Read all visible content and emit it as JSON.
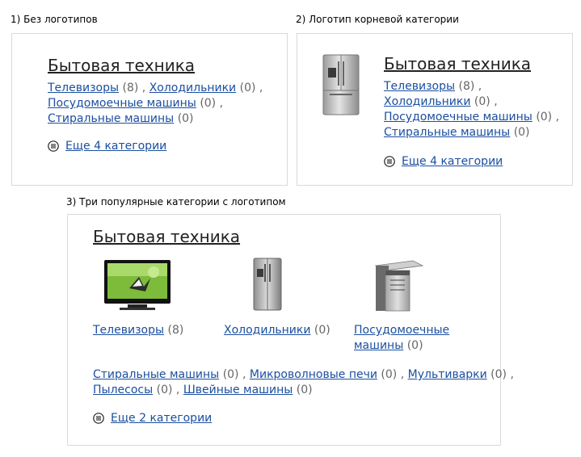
{
  "example1": {
    "caption": "1) Без логотипов",
    "title": "Бытовая техника",
    "categories": [
      {
        "name": "Телевизоры",
        "count": "(8)",
        "sep": ","
      },
      {
        "name": "Холодильники",
        "count": "(0)",
        "sep": ","
      },
      {
        "name": "Посудомоечные машины",
        "count": "(0)",
        "sep": ","
      },
      {
        "name": "Стиральные машины",
        "count": "(0)",
        "sep": ""
      }
    ],
    "more_label": "Еще 4 категории"
  },
  "example2": {
    "caption": "2) Логотип корневой категории",
    "title": "Бытовая техника",
    "logo_icon": "refrigerator-icon",
    "categories": [
      {
        "name": "Телевизоры",
        "count": "(8)",
        "sep": ","
      },
      {
        "name": "Холодильники",
        "count": "(0)",
        "sep": ","
      },
      {
        "name": "Посудомоечные машины",
        "count": "(0)",
        "sep": ","
      },
      {
        "name": "Стиральные машины",
        "count": "(0)",
        "sep": ""
      }
    ],
    "more_label": "Еще 4 категории"
  },
  "example3": {
    "caption": "3) Три популярные категории с логотипом",
    "title": "Бытовая техника",
    "popular": [
      {
        "name": "Телевизоры",
        "count": "(8)",
        "icon": "tv-icon"
      },
      {
        "name": "Холодильники",
        "count": "(0)",
        "icon": "refrigerator-icon"
      },
      {
        "name_line1": "Посудомоечные",
        "name_line2": "машины",
        "count": "(0)",
        "icon": "dishwasher-icon"
      }
    ],
    "others": [
      {
        "name": "Стиральные машины",
        "count": "(0)",
        "sep": ","
      },
      {
        "name": "Микроволновые печи",
        "count": "(0)",
        "sep": ","
      },
      {
        "name": "Мультиварки",
        "count": "(0)",
        "sep": ","
      },
      {
        "name": "Пылесосы",
        "count": "(0)",
        "sep": ","
      },
      {
        "name": "Швейные машины",
        "count": "(0)",
        "sep": ""
      }
    ],
    "more_label": "Еще 2 категории"
  },
  "colors": {
    "link": "#1b4fa0",
    "count": "#666666",
    "border": "#d9d9d9"
  }
}
